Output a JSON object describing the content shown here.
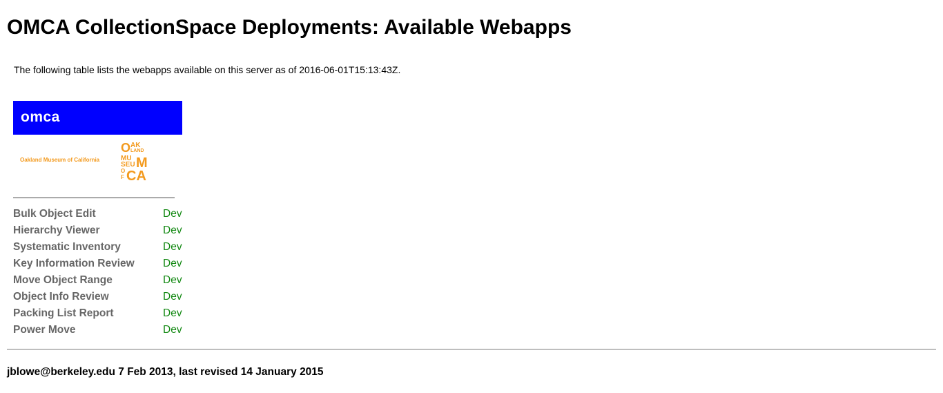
{
  "page": {
    "title": "OMCA CollectionSpace Deployments: Available Webapps",
    "intro": "The following table lists the webapps available on this server as of 2016-06-01T15:13:43Z."
  },
  "logo": {
    "bar_text": "omca",
    "museum_name": "Oakland Museum of California",
    "mark_text": "OAK LAND MUSEUM OF CA",
    "bar_color": "#0000ff",
    "accent_color": "#f39a1e"
  },
  "apps": [
    {
      "name": "Bulk Object Edit",
      "link": "Dev"
    },
    {
      "name": "Hierarchy Viewer",
      "link": "Dev"
    },
    {
      "name": "Systematic Inventory",
      "link": "Dev"
    },
    {
      "name": "Key Information Review",
      "link": "Dev"
    },
    {
      "name": "Move Object Range",
      "link": "Dev"
    },
    {
      "name": "Object Info Review",
      "link": "Dev"
    },
    {
      "name": "Packing List Report",
      "link": "Dev"
    },
    {
      "name": "Power Move",
      "link": "Dev"
    }
  ],
  "footer": {
    "text": "jblowe@berkeley.edu 7 Feb 2013, last revised 14 January 2015"
  },
  "colors": {
    "link": "#118811",
    "app_name": "#666666"
  }
}
